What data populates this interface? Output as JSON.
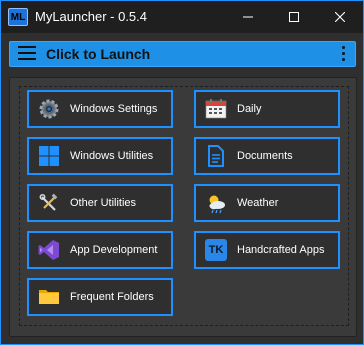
{
  "window": {
    "icon_text": "ML",
    "title": "MyLauncher - 0.5.4"
  },
  "header": {
    "title": "Click to Launch"
  },
  "tiles": [
    {
      "label": "Windows Settings",
      "icon": "gear-icon"
    },
    {
      "label": "Daily",
      "icon": "calendar-icon"
    },
    {
      "label": "Windows Utilities",
      "icon": "windows-logo-icon"
    },
    {
      "label": "Documents",
      "icon": "document-icon"
    },
    {
      "label": "Other Utilities",
      "icon": "tools-icon"
    },
    {
      "label": "Weather",
      "icon": "weather-icon"
    },
    {
      "label": "App Development",
      "icon": "visual-studio-icon"
    },
    {
      "label": "Handcrafted Apps",
      "icon": "tk-badge-icon",
      "badge_text": "TK"
    },
    {
      "label": "Frequent Folders",
      "icon": "folder-icon"
    }
  ],
  "colors": {
    "accent": "#1e90ff",
    "header_bg": "#1e90e6",
    "window_bg": "#2f2f2f",
    "panel_bg": "#3a3a3a"
  }
}
